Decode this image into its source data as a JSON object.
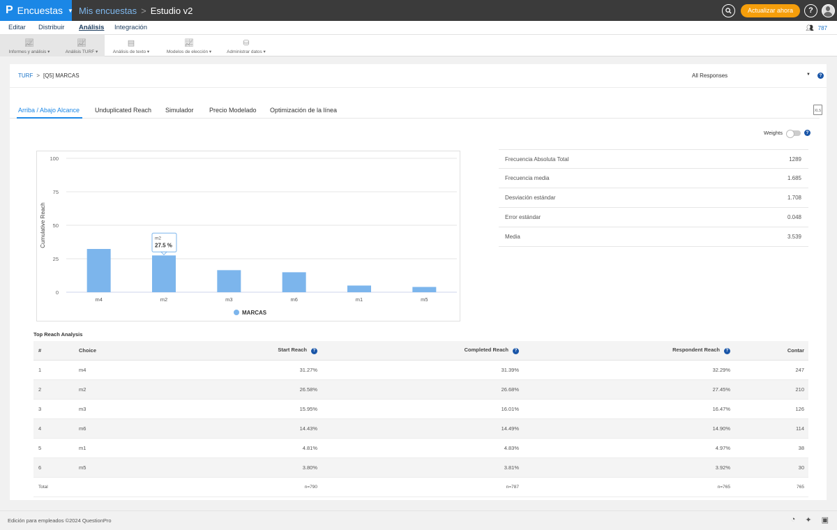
{
  "topbar": {
    "brand_logo": "P",
    "brand_name": "Encuestas",
    "crumb_surveys": "Mis encuestas",
    "crumb_separator": ">",
    "crumb_study": "Estudio v2",
    "upgrade_label": "Actualizar ahora",
    "help_label": "?"
  },
  "nav": {
    "items": [
      "Editar",
      "Distribuir",
      "Análisis",
      "Integración"
    ],
    "active": "Análisis",
    "users_count": "787"
  },
  "toolbar": {
    "tools": [
      {
        "label": "Informes y análisis",
        "icon": "line-chart-icon"
      },
      {
        "label": "Análisis TURF",
        "icon": "chart-icon"
      },
      {
        "label": "Análisis de texto",
        "icon": "document-icon"
      },
      {
        "label": "Modelos de elección",
        "icon": "chart-icon"
      },
      {
        "label": "Administrar datos",
        "icon": "database-icon"
      }
    ]
  },
  "header": {
    "crumb_link": "TURF",
    "crumb_separator": ">",
    "crumb_current": "[Q5] MARCAS",
    "responses_filter": "All Responses"
  },
  "tabs": [
    "Arriba / Abajo Alcance",
    "Unduplicated Reach",
    "Simulador",
    "Precio Modelado",
    "Optimización de la línea"
  ],
  "export_label": "XLS",
  "weights_label": "Weights",
  "chart_data": {
    "type": "bar",
    "categories": [
      "m4",
      "m2",
      "m3",
      "m6",
      "m1",
      "m5"
    ],
    "values": [
      32.29,
      27.45,
      16.47,
      14.9,
      4.97,
      3.92
    ],
    "ylabel": "Cumulative Reach",
    "ylim": [
      0,
      100
    ],
    "yticks": [
      0,
      25,
      50,
      75,
      100
    ],
    "legend": "MARCAS",
    "legend_position": "bottom",
    "color": "#7cb5ec",
    "tooltip": {
      "category": "m2",
      "value": "27.5 %"
    }
  },
  "stats": [
    {
      "label": "Frecuencia Absoluta Total",
      "value": "1289"
    },
    {
      "label": "Frecuencia media",
      "value": "1.685"
    },
    {
      "label": "Desviación estándar",
      "value": "1.708"
    },
    {
      "label": "Error estándar",
      "value": "0.048"
    },
    {
      "label": "Media",
      "value": "3.539"
    }
  ],
  "table": {
    "title": "Top Reach Analysis",
    "headers": {
      "num": "#",
      "choice": "Choice",
      "start": "Start Reach",
      "completed": "Completed Reach",
      "respondent": "Respondent Reach",
      "count": "Contar"
    },
    "rows": [
      {
        "num": "1",
        "choice": "m4",
        "start": "31.27%",
        "completed": "31.39%",
        "respondent": "32.29%",
        "count": "247"
      },
      {
        "num": "2",
        "choice": "m2",
        "start": "26.58%",
        "completed": "26.68%",
        "respondent": "27.45%",
        "count": "210"
      },
      {
        "num": "3",
        "choice": "m3",
        "start": "15.95%",
        "completed": "16.01%",
        "respondent": "16.47%",
        "count": "126"
      },
      {
        "num": "4",
        "choice": "m6",
        "start": "14.43%",
        "completed": "14.49%",
        "respondent": "14.90%",
        "count": "114"
      },
      {
        "num": "5",
        "choice": "m1",
        "start": "4.81%",
        "completed": "4.83%",
        "respondent": "4.97%",
        "count": "38"
      },
      {
        "num": "6",
        "choice": "m5",
        "start": "3.80%",
        "completed": "3.81%",
        "respondent": "3.92%",
        "count": "30"
      }
    ],
    "total": {
      "label": "Total",
      "start": "n=790",
      "completed": "n=787",
      "respondent": "n=765",
      "count": "765"
    }
  },
  "footer": {
    "copyright": "Edición para empleados ©2024 QuestionPro"
  }
}
